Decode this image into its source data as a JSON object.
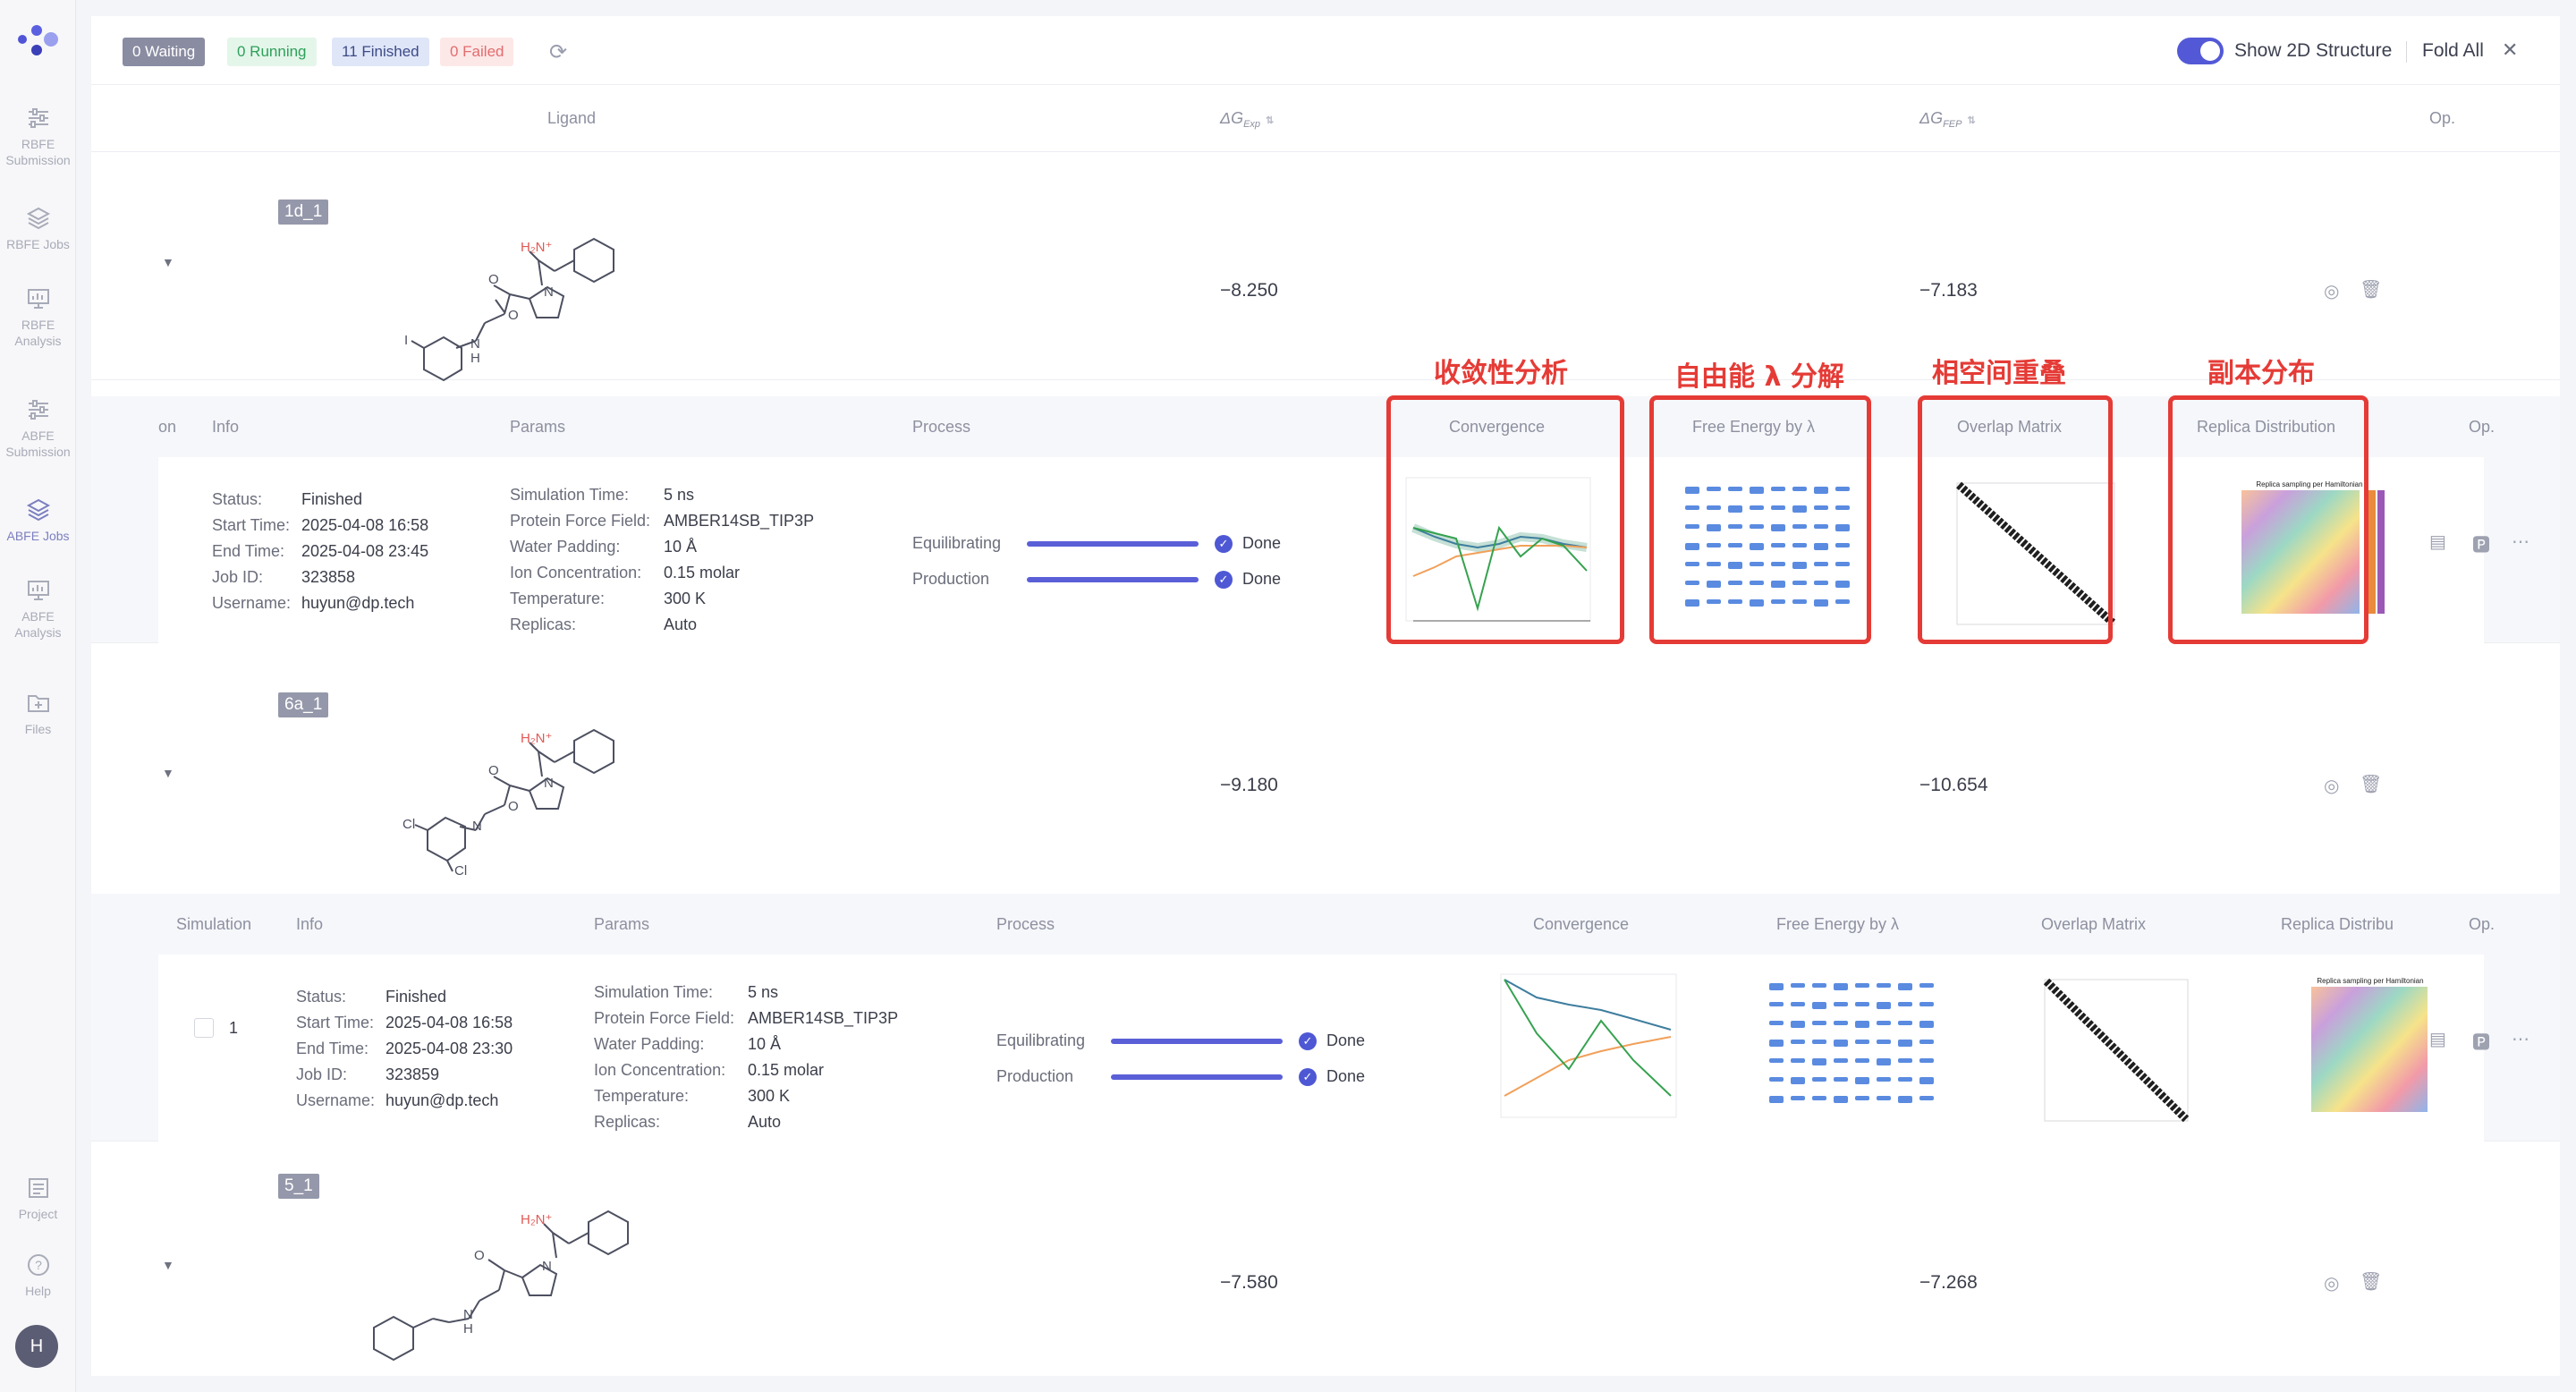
{
  "sidebar": {
    "items": [
      {
        "label": "RBFE\nSubmission",
        "icon": "sliders-icon"
      },
      {
        "label": "RBFE Jobs",
        "icon": "layers-icon"
      },
      {
        "label": "RBFE\nAnalysis",
        "icon": "monitor-icon"
      },
      {
        "label": "ABFE\nSubmission",
        "icon": "sliders-icon"
      },
      {
        "label": "ABFE Jobs",
        "icon": "layers-icon"
      },
      {
        "label": "ABFE\nAnalysis",
        "icon": "monitor-icon"
      },
      {
        "label": "Files",
        "icon": "folder-icon"
      }
    ],
    "project": "Project",
    "help": "Help",
    "avatar": "H"
  },
  "status": {
    "waiting": "0 Waiting",
    "running": "0 Running",
    "finished": "11 Finished",
    "failed": "0 Failed"
  },
  "toolbar": {
    "show2d": "Show 2D Structure",
    "fold_all": "Fold All",
    "show2d_on": true
  },
  "columns": {
    "ligand": "Ligand",
    "dg_exp": "ΔG",
    "dg_exp_sub": "Exp",
    "dg_fep": "ΔG",
    "dg_fep_sub": "FEP",
    "op": "Op."
  },
  "rows": [
    {
      "id": "1d_1",
      "dg_exp": "−8.250",
      "dg_fep": "−7.183"
    },
    {
      "id": "6a_1",
      "dg_exp": "−9.180",
      "dg_fep": "−10.654"
    },
    {
      "id": "5_1",
      "dg_exp": "−7.580",
      "dg_fep": "−7.268"
    }
  ],
  "detail_header": {
    "simulation": "Simulation",
    "simulation_cut": "on",
    "info": "Info",
    "params": "Params",
    "process": "Process",
    "convergence": "Convergence",
    "free_energy": "Free Energy by λ",
    "overlap": "Overlap Matrix",
    "replica": "Replica Distribution",
    "replica_cut": "Replica Distribu",
    "op": "Op."
  },
  "labels": {
    "status": "Status:",
    "start": "Start Time:",
    "end": "End Time:",
    "job": "Job ID:",
    "user": "Username:",
    "sim_time": "Simulation Time:",
    "force_field": "Protein Force Field:",
    "water": "Water Padding:",
    "ion": "Ion Concentration:",
    "temp": "Temperature:",
    "replicas": "Replicas:",
    "equil": "Equilibrating",
    "prod": "Production",
    "done": "Done"
  },
  "sim1": {
    "status": "Finished",
    "start": "2025-04-08 16:58",
    "end": "2025-04-08 23:45",
    "job": "323858",
    "user": "huyun@dp.tech",
    "sim_time": "5 ns",
    "force_field": "AMBER14SB_TIP3P",
    "water": "10 Å",
    "ion": "0.15 molar",
    "temp": "300 K",
    "replicas": "Auto"
  },
  "sim2": {
    "index": "1",
    "status": "Finished",
    "start": "2025-04-08 16:58",
    "end": "2025-04-08 23:30",
    "job": "323859",
    "user": "huyun@dp.tech",
    "sim_time": "5 ns",
    "force_field": "AMBER14SB_TIP3P",
    "water": "10 Å",
    "ion": "0.15 molar",
    "temp": "300 K",
    "replicas": "Auto"
  },
  "annotations": {
    "convergence": "收敛性分析",
    "free_energy": "自由能 λ 分解",
    "overlap": "相空间重叠",
    "replica": "副本分布",
    "color": "#e53b36"
  },
  "replica_title": "Replica sampling per Hamiltonian",
  "colors": {
    "accent": "#5359d6",
    "annotation": "#e53b36"
  }
}
